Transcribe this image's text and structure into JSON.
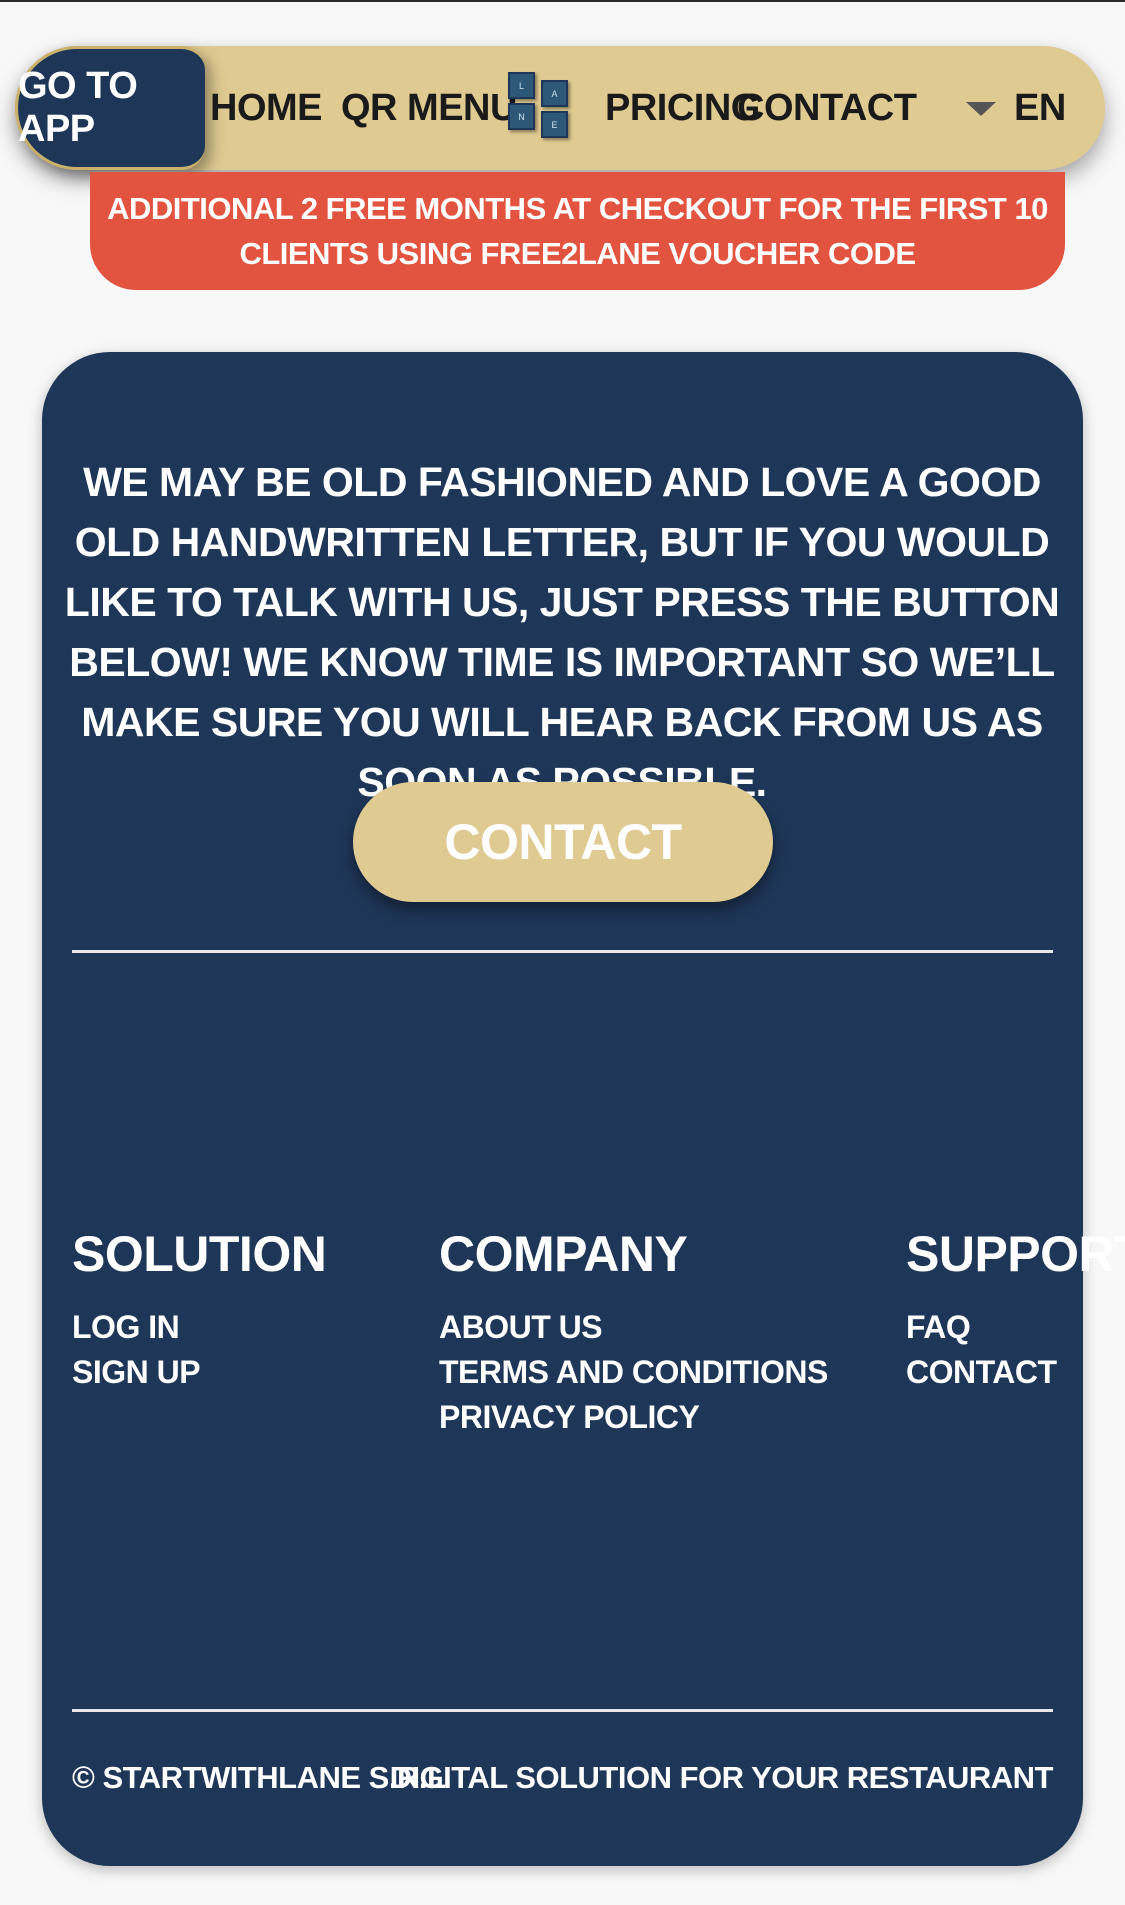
{
  "nav": {
    "go_to_app": "GO TO APP",
    "home": "HOME",
    "qr_menu": "QR MENU",
    "logo_letters": [
      "L",
      "A",
      "N",
      "E"
    ],
    "pricing": "PRICING",
    "contact": "CONTACT",
    "language": "EN"
  },
  "promo": {
    "text": "ADDITIONAL 2 FREE MONTHS AT CHECKOUT FOR THE FIRST 10 CLIENTS USING FREE2LANE VOUCHER CODE"
  },
  "main": {
    "intro": "WE MAY BE OLD FASHIONED AND LOVE A GOOD OLD HANDWRITTEN LETTER, BUT IF YOU WOULD LIKE TO TALK WITH US, JUST PRESS THE BUTTON BELOW!  WE KNOW TIME IS IMPORTANT SO WE’LL MAKE SURE YOU WILL HEAR BACK FROM US AS SOON AS POSSIBLE.",
    "contact_button": "CONTACT"
  },
  "footer": {
    "solution": {
      "title": "SOLUTION",
      "links": [
        "LOG IN",
        "SIGN UP"
      ]
    },
    "company": {
      "title": "COMPANY",
      "links": [
        "ABOUT US",
        "TERMS AND CONDITIONS",
        "PRIVACY POLICY"
      ]
    },
    "support": {
      "title": "SUPPORT",
      "links": [
        "FAQ",
        "CONTACT"
      ]
    },
    "copyright": "© STARTWITHLANE S.R.L",
    "tagline": "DIGITAL SOLUTION FOR YOUR RESTAURANT"
  },
  "colors": {
    "navy": "#1e3658",
    "gold": "#dfca91",
    "promo_red": "#e35440"
  }
}
